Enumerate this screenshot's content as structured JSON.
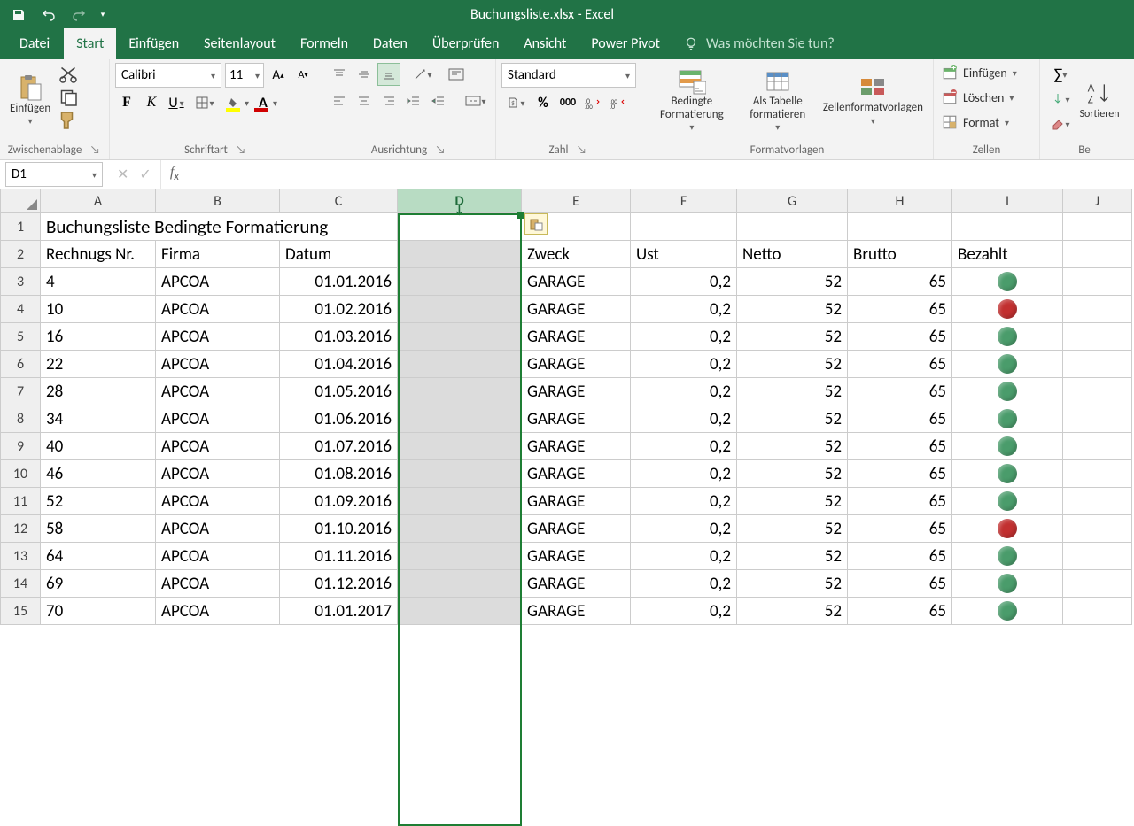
{
  "title": "Buchungsliste.xlsx - Excel",
  "tabs": {
    "file": "Datei",
    "start": "Start",
    "insert": "Einfügen",
    "layout": "Seitenlayout",
    "formulas": "Formeln",
    "data": "Daten",
    "review": "Überprüfen",
    "view": "Ansicht",
    "powerpivot": "Power Pivot",
    "tellme": "Was möchten Sie tun?"
  },
  "ribbon": {
    "clipboard": {
      "label": "Zwischenablage",
      "paste": "Einfügen"
    },
    "font": {
      "label": "Schriftart",
      "name": "Calibri",
      "size": "11",
      "bold": "F",
      "italic": "K",
      "underline": "U"
    },
    "alignment": {
      "label": "Ausrichtung"
    },
    "number": {
      "label": "Zahl",
      "format": "Standard",
      "thousands": "000"
    },
    "styles": {
      "label": "Formatvorlagen",
      "cond": "Bedingte Formatierung",
      "table": "Als Tabelle formatieren",
      "cell": "Zellenformatvorlagen"
    },
    "cells": {
      "label": "Zellen",
      "insert": "Einfügen",
      "delete": "Löschen",
      "format": "Format"
    },
    "editing": {
      "sort": "Sortieren",
      "find": "Be"
    }
  },
  "namebox": "D1",
  "columns": [
    "A",
    "B",
    "C",
    "D",
    "E",
    "F",
    "G",
    "H",
    "I",
    "J"
  ],
  "sheet": {
    "title": "Buchungsliste Bedingte Formatierung",
    "headers": {
      "A": "Rechnugs Nr.",
      "B": "Firma",
      "C": "Datum",
      "E": "Zweck",
      "F": "Ust",
      "G": "Netto",
      "H": "Brutto",
      "I": "Bezahlt"
    },
    "rows": [
      {
        "nr": "4",
        "firma": "APCOA",
        "datum": "01.01.2016",
        "zweck": "GARAGE",
        "ust": "0,2",
        "netto": "52",
        "brutto": "65",
        "paid": "green"
      },
      {
        "nr": "10",
        "firma": "APCOA",
        "datum": "01.02.2016",
        "zweck": "GARAGE",
        "ust": "0,2",
        "netto": "52",
        "brutto": "65",
        "paid": "red"
      },
      {
        "nr": "16",
        "firma": "APCOA",
        "datum": "01.03.2016",
        "zweck": "GARAGE",
        "ust": "0,2",
        "netto": "52",
        "brutto": "65",
        "paid": "green"
      },
      {
        "nr": "22",
        "firma": "APCOA",
        "datum": "01.04.2016",
        "zweck": "GARAGE",
        "ust": "0,2",
        "netto": "52",
        "brutto": "65",
        "paid": "green"
      },
      {
        "nr": "28",
        "firma": "APCOA",
        "datum": "01.05.2016",
        "zweck": "GARAGE",
        "ust": "0,2",
        "netto": "52",
        "brutto": "65",
        "paid": "green"
      },
      {
        "nr": "34",
        "firma": "APCOA",
        "datum": "01.06.2016",
        "zweck": "GARAGE",
        "ust": "0,2",
        "netto": "52",
        "brutto": "65",
        "paid": "green"
      },
      {
        "nr": "40",
        "firma": "APCOA",
        "datum": "01.07.2016",
        "zweck": "GARAGE",
        "ust": "0,2",
        "netto": "52",
        "brutto": "65",
        "paid": "green"
      },
      {
        "nr": "46",
        "firma": "APCOA",
        "datum": "01.08.2016",
        "zweck": "GARAGE",
        "ust": "0,2",
        "netto": "52",
        "brutto": "65",
        "paid": "green"
      },
      {
        "nr": "52",
        "firma": "APCOA",
        "datum": "01.09.2016",
        "zweck": "GARAGE",
        "ust": "0,2",
        "netto": "52",
        "brutto": "65",
        "paid": "green"
      },
      {
        "nr": "58",
        "firma": "APCOA",
        "datum": "01.10.2016",
        "zweck": "GARAGE",
        "ust": "0,2",
        "netto": "52",
        "brutto": "65",
        "paid": "red"
      },
      {
        "nr": "64",
        "firma": "APCOA",
        "datum": "01.11.2016",
        "zweck": "GARAGE",
        "ust": "0,2",
        "netto": "52",
        "brutto": "65",
        "paid": "green"
      },
      {
        "nr": "69",
        "firma": "APCOA",
        "datum": "01.12.2016",
        "zweck": "GARAGE",
        "ust": "0,2",
        "netto": "52",
        "brutto": "65",
        "paid": "green"
      },
      {
        "nr": "70",
        "firma": "APCOA",
        "datum": "01.01.2017",
        "zweck": "GARAGE",
        "ust": "0,2",
        "netto": "52",
        "brutto": "65",
        "paid": "green"
      }
    ]
  }
}
